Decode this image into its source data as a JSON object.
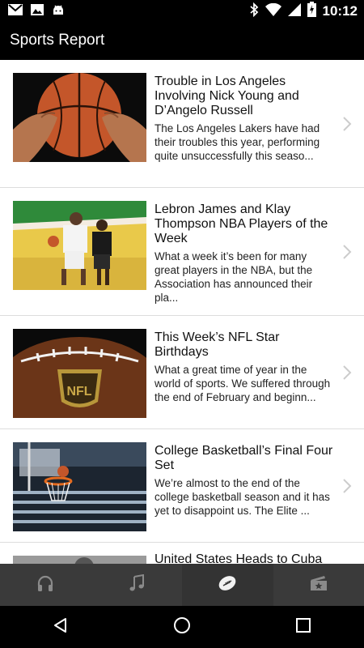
{
  "status_bar": {
    "time": "10:12",
    "icons": [
      "gmail-icon",
      "image-icon",
      "android-icon",
      "bluetooth-icon",
      "wifi-icon",
      "signal-icon",
      "battery-charging-icon"
    ]
  },
  "app_bar": {
    "title": "Sports Report"
  },
  "articles": [
    {
      "title": "Trouble in Los Angeles Involving Nick Young and D’Angelo Russell",
      "summary": "The Los Angeles Lakers have had their troubles this year, performing quite unsuccessfully this seaso...",
      "thumbnail": "basketball-hands-image"
    },
    {
      "title": "Lebron James and Klay Thompson NBA Players of the Week",
      "summary": "What a week it’s been for many great players in the NBA, but the Association has announced their pla...",
      "thumbnail": "basketball-players-image"
    },
    {
      "title": "This Week’s NFL Star Birthdays",
      "summary": "What a great time of year in the world of sports. We suffered through the end of February and beginn...",
      "thumbnail": "nfl-football-image"
    },
    {
      "title": "College Basketball’s Final Four Set",
      "summary": "We’re almost to the end of the college basketball season and it has yet to disappoint us. The Elite ...",
      "thumbnail": "basketball-hoop-image"
    },
    {
      "title": "United States Heads to Cuba",
      "summary": "",
      "thumbnail": "partial-image"
    }
  ],
  "tabs": [
    {
      "icon": "headphones-icon",
      "active": false
    },
    {
      "icon": "music-note-icon",
      "active": false
    },
    {
      "icon": "football-icon",
      "active": true
    },
    {
      "icon": "ticket-icon",
      "active": false
    }
  ],
  "nav": [
    "back-icon",
    "home-icon",
    "recents-icon"
  ],
  "colors": {
    "bar_bg": "#000000",
    "tab_bg": "#3a3a3a",
    "content_bg": "#ffffff",
    "chevron": "#cccccc"
  }
}
